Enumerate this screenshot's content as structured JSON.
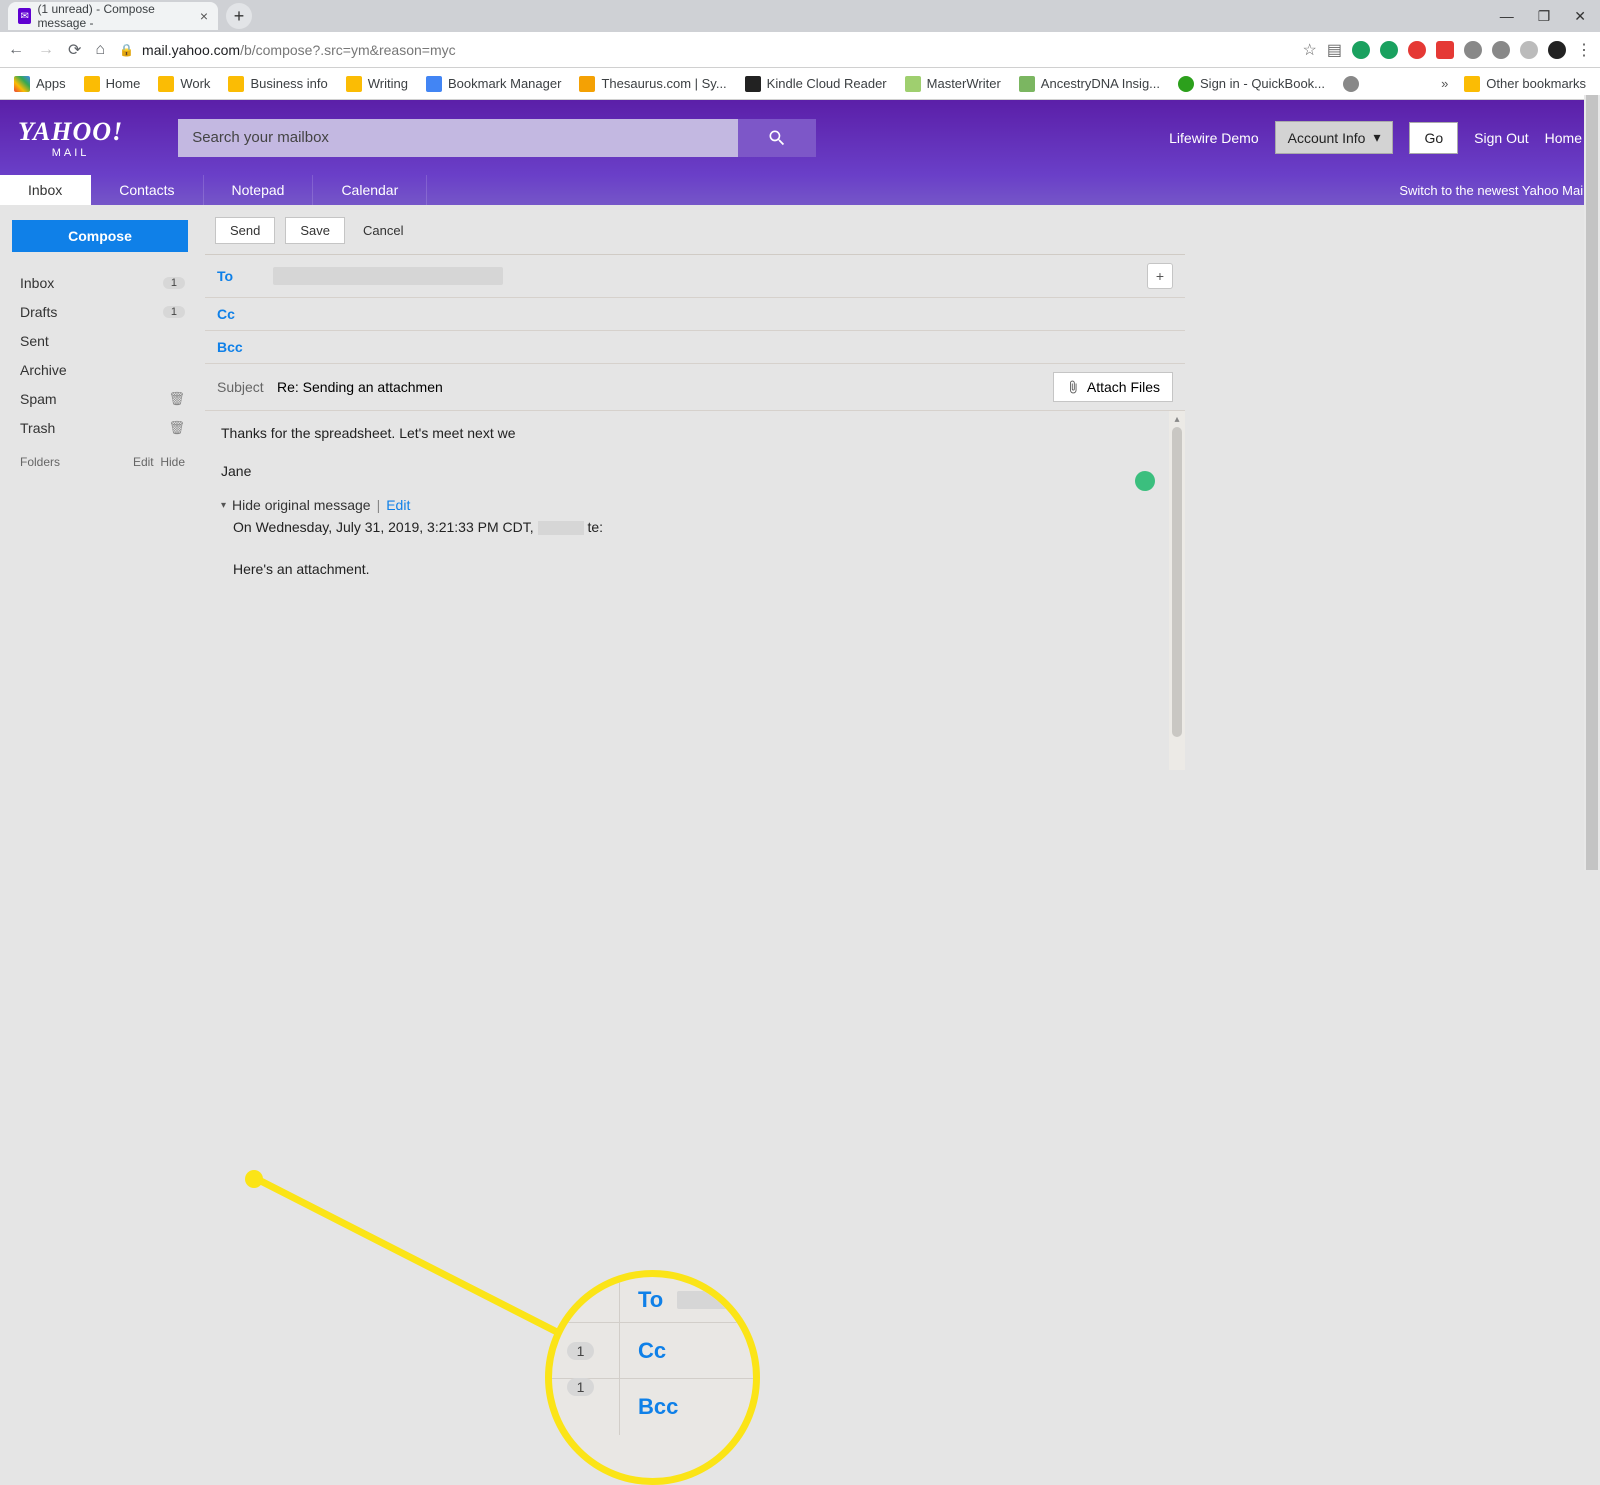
{
  "browser": {
    "tab_title": "(1 unread) - Compose message - ",
    "url_host": "mail.yahoo.com",
    "url_path": "/b/compose?.src=ym&reason=myc",
    "bookmarks": [
      "Apps",
      "Home",
      "Work",
      "Business info",
      "Writing",
      "Bookmark Manager",
      "Thesaurus.com | Sy...",
      "Kindle Cloud Reader",
      "MasterWriter",
      "AncestryDNA Insig...",
      "Sign in - QuickBook..."
    ],
    "other_bookmarks": "Other bookmarks"
  },
  "header": {
    "brand": "YAHOO!",
    "brand_sub": "MAIL",
    "search_placeholder": "Search your mailbox",
    "user": "Lifewire Demo",
    "account_info": "Account Info",
    "go": "Go",
    "sign_out": "Sign Out",
    "home": "Home"
  },
  "nav": {
    "inbox": "Inbox",
    "contacts": "Contacts",
    "notepad": "Notepad",
    "calendar": "Calendar",
    "switch": "Switch to the newest Yahoo Mail"
  },
  "sidebar": {
    "compose": "Compose",
    "folders": [
      {
        "name": "Inbox",
        "badge": "1"
      },
      {
        "name": "Drafts",
        "badge": "1"
      },
      {
        "name": "Sent"
      },
      {
        "name": "Archive"
      },
      {
        "name": "Spam",
        "trash": true
      },
      {
        "name": "Trash",
        "trash": true
      }
    ],
    "folders_label": "Folders",
    "edit": "Edit",
    "hide": "Hide"
  },
  "compose": {
    "send": "Send",
    "save": "Save",
    "cancel": "Cancel",
    "to_label": "To",
    "cc_label": "Cc",
    "bcc_label": "Bcc",
    "subject_label": "Subject",
    "subject_value": "Re: Sending an attachmen",
    "attach": "Attach Files",
    "body_line1": "Thanks for the spreadsheet. Let's meet next we",
    "body_line2": "Jane",
    "hide_original": "Hide original message",
    "edit": "Edit",
    "quote_prefix": "On Wednesday, July 31, 2019, 3:21:33 PM CDT,",
    "quote_suffix": "te:",
    "quote_body": "Here's an attachment."
  },
  "zoom": {
    "badge1": "1",
    "to": "To",
    "badge2": "1",
    "cc": "Cc",
    "bcc": "Bcc"
  }
}
